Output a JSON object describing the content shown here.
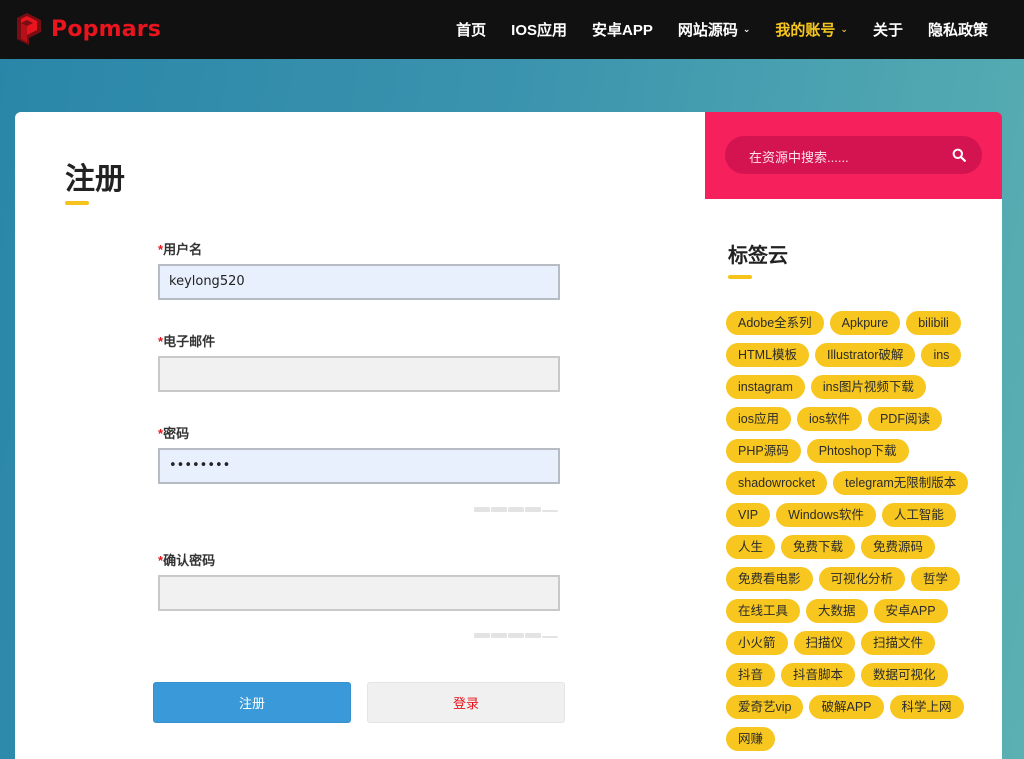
{
  "header": {
    "logo_text": "Popmars",
    "nav": [
      {
        "label": "首页",
        "active": false,
        "dropdown": false
      },
      {
        "label": "IOS应用",
        "active": false,
        "dropdown": false
      },
      {
        "label": "安卓APP",
        "active": false,
        "dropdown": false
      },
      {
        "label": "网站源码",
        "active": false,
        "dropdown": true
      },
      {
        "label": "我的账号",
        "active": true,
        "dropdown": true
      },
      {
        "label": "关于",
        "active": false,
        "dropdown": false
      },
      {
        "label": "隐私政策",
        "active": false,
        "dropdown": false
      }
    ]
  },
  "form": {
    "title": "注册",
    "required_mark": "*",
    "username": {
      "label": "用户名",
      "value": "keylong520"
    },
    "email": {
      "label": "电子邮件",
      "value": ""
    },
    "password": {
      "label": "密码",
      "value": "••••••••"
    },
    "confirm_password": {
      "label": "确认密码",
      "value": ""
    },
    "register_label": "注册",
    "login_label": "登录"
  },
  "sidebar": {
    "search_placeholder": "在资源中搜索......",
    "tags_title": "标签云",
    "tags": [
      "Adobe全系列",
      "Apkpure",
      "bilibili",
      "HTML模板",
      "Illustrator破解",
      "ins",
      "instagram",
      "ins图片视频下载",
      "ios应用",
      "ios软件",
      "PDF阅读",
      "PHP源码",
      "Phtoshop下载",
      "shadowrocket",
      "telegram无限制版本",
      "VIP",
      "Windows软件",
      "人工智能",
      "人生",
      "免费下载",
      "免费源码",
      "免费看电影",
      "可视化分析",
      "哲学",
      "在线工具",
      "大数据",
      "安卓APP",
      "小火箭",
      "扫描仪",
      "扫描文件",
      "抖音",
      "抖音脚本",
      "数据可视化",
      "爱奇艺vip",
      "破解APP",
      "科学上网",
      "网赚"
    ]
  },
  "colors": {
    "logo_red": "#e8141e",
    "nav_active": "#f7c61f",
    "search_bg": "#f5205c",
    "tag_bg": "#f7c61f",
    "register_btn": "#3a9ad9"
  }
}
